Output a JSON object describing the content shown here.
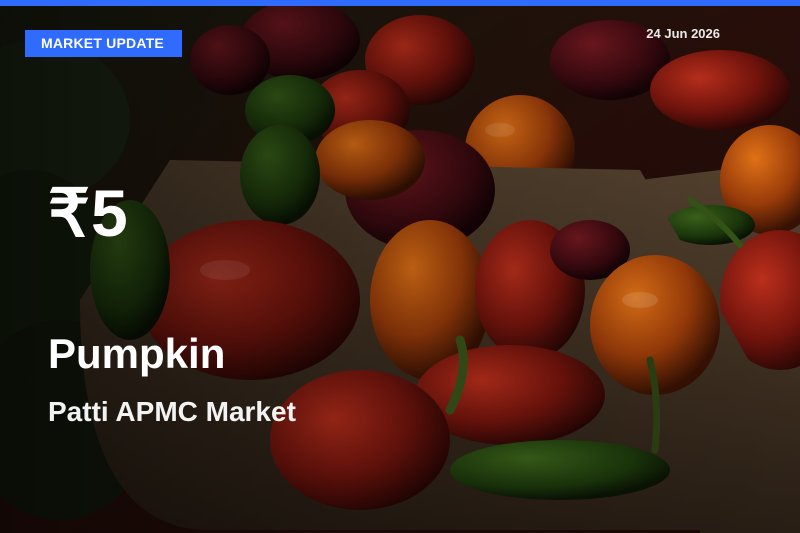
{
  "header": {
    "badge_label": "MARKET UPDATE",
    "date": "24 Jun 2026"
  },
  "main": {
    "price": "₹5",
    "commodity": "Pumpkin",
    "market": "Patti APMC Market"
  },
  "colors": {
    "accent": "#2f6bff",
    "text": "#ffffff",
    "date_text": "#e9e9e9"
  }
}
